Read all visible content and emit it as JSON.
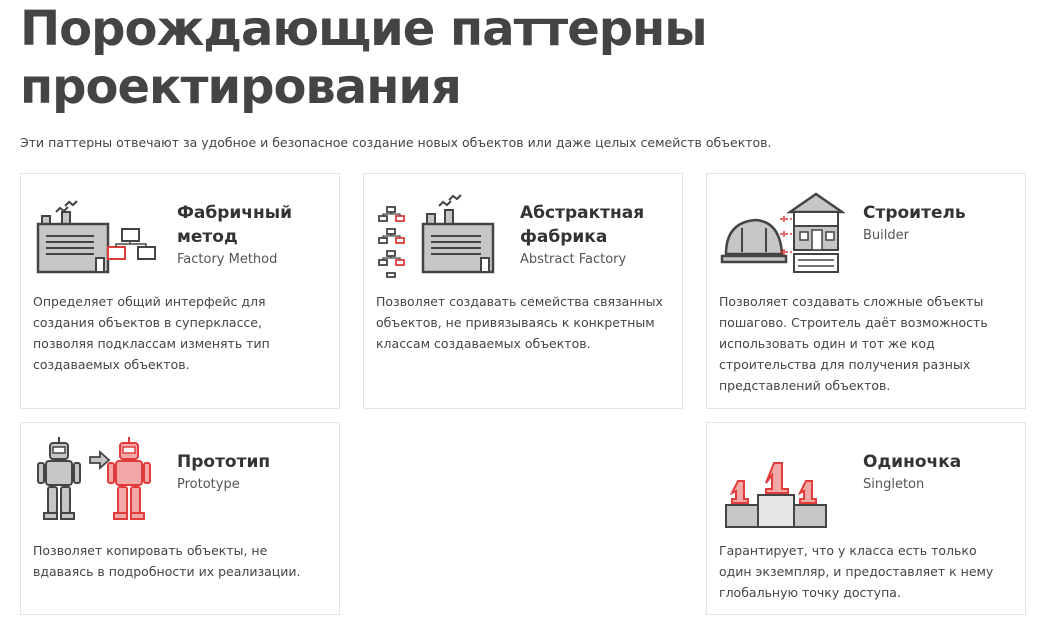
{
  "page": {
    "title_line1": "Порождающие паттерны",
    "title_line2": "проектирования",
    "intro": "Эти паттерны отвечают за удобное и безопасное создание новых объектов или даже целых семейств объектов."
  },
  "colors": {
    "accent": "#e03c3c",
    "outline": "#444444",
    "fill_gray": "#c6c6c6",
    "border": "#e4e4e4"
  },
  "patterns": [
    {
      "title_l1": "Фабричный",
      "title_l2": "метод",
      "subtitle": "Factory Method",
      "description": "Определяет общий интерфейс для создания объектов в суперклассе, позволяя подклассам изменять тип создаваемых объектов.",
      "icon": "factory-method-icon"
    },
    {
      "title_l1": "Абстрактная",
      "title_l2": "фабрика",
      "subtitle": "Abstract Factory",
      "description": "Позволяет создавать семейства связанных объектов, не привязываясь к конкретным классам создаваемых объектов.",
      "icon": "abstract-factory-icon"
    },
    {
      "title_l1": "Строитель",
      "title_l2": "",
      "subtitle": "Builder",
      "description": "Позволяет создавать сложные объекты пошагово. Строитель даёт возможность использовать один и тот же код строительства для получения разных представлений объектов.",
      "icon": "builder-icon"
    },
    {
      "title_l1": "Прототип",
      "title_l2": "",
      "subtitle": "Prototype",
      "description": "Позволяет копировать объекты, не вдаваясь в подробности их реализации.",
      "icon": "prototype-icon"
    },
    {
      "title_l1": "Одиночка",
      "title_l2": "",
      "subtitle": "Singleton",
      "description": "Гарантирует, что у класса есть только один экземпляр, и предоставляет к нему глобальную точку доступа.",
      "icon": "singleton-icon"
    }
  ]
}
